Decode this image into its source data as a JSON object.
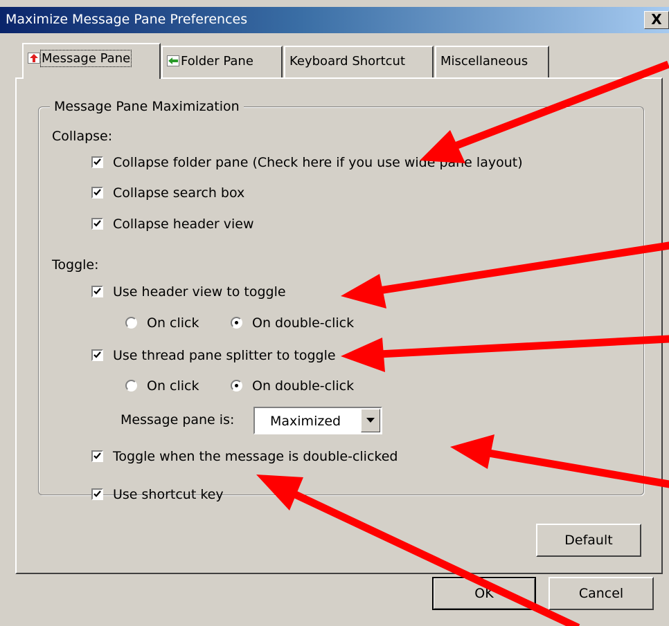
{
  "window": {
    "title": "Maximize Message Pane Preferences",
    "close_symbol": "X"
  },
  "tabs": [
    {
      "label": "Message Pane",
      "icon": "up-arrow-icon",
      "active": true
    },
    {
      "label": "Folder Pane",
      "icon": "left-arrow-icon",
      "active": false
    },
    {
      "label": "Keyboard Shortcut",
      "active": false
    },
    {
      "label": "Miscellaneous",
      "active": false
    }
  ],
  "group": {
    "legend": "Message Pane Maximization",
    "collapse": {
      "heading": "Collapse:",
      "folder_pane": {
        "label": "Collapse folder pane (Check here if you use wide pane layout)",
        "checked": true
      },
      "search_box": {
        "label": "Collapse search box",
        "checked": true
      },
      "header_view": {
        "label": "Collapse header view",
        "checked": true
      }
    },
    "toggle": {
      "heading": "Toggle:",
      "header_view": {
        "label": "Use header view to toggle",
        "checked": true,
        "on_click": "On click",
        "on_double_click": "On double-click",
        "selected": "On double-click"
      },
      "splitter": {
        "label": "Use thread pane splitter to toggle",
        "checked": true,
        "on_click": "On click",
        "on_double_click": "On double-click",
        "selected": "On double-click"
      },
      "message_pane_state": {
        "label": "Message pane is:",
        "value": "Maximized"
      },
      "double_click_message": {
        "label": "Toggle when the message is double-clicked",
        "checked": true
      },
      "shortcut_key": {
        "label": "Use shortcut key",
        "checked": true
      }
    }
  },
  "buttons": {
    "default": "Default",
    "ok": "OK",
    "cancel": "Cancel"
  },
  "colors": {
    "dialog_face": "#d4d0c8",
    "title_start": "#0a246a",
    "title_end": "#a6caf0",
    "annotation_arrow": "#ff0000"
  }
}
